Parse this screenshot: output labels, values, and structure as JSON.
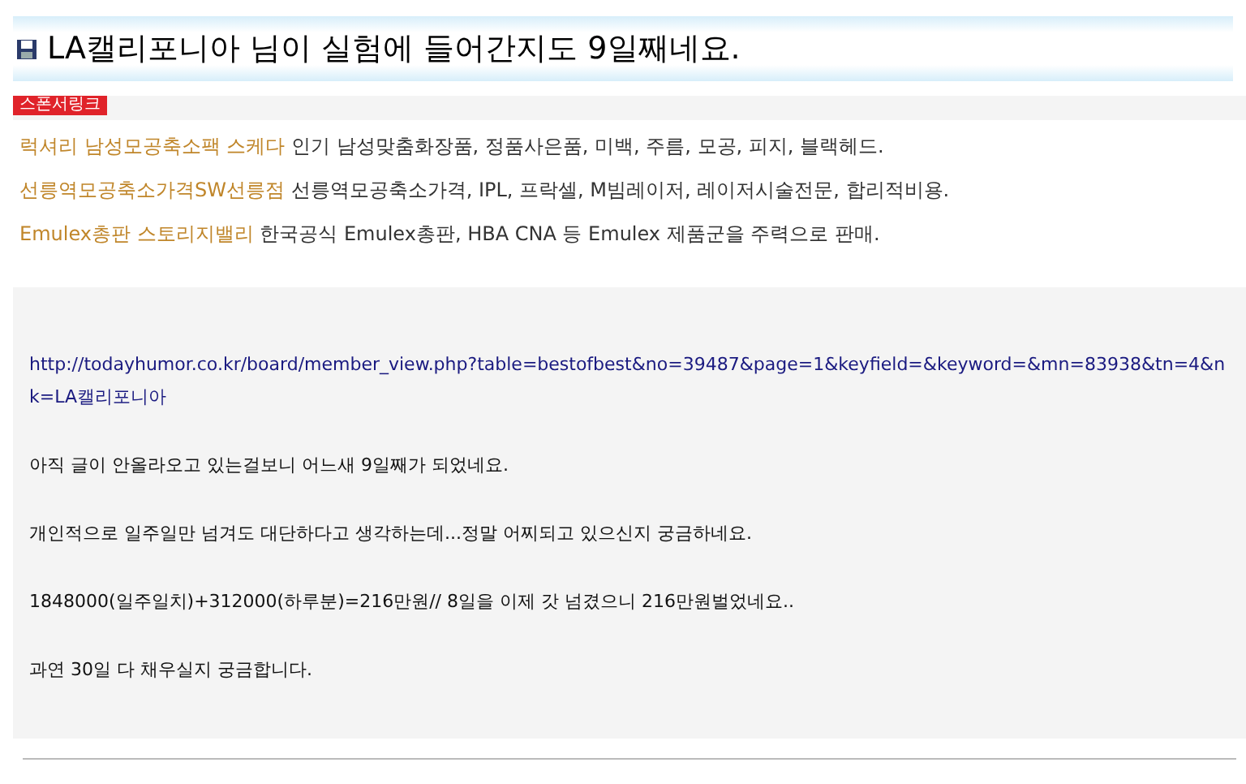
{
  "title": "LA캘리포니아 님이 실험에 들어간지도 9일째네요.",
  "sponsor": {
    "badge": "스폰서링크",
    "ads": [
      {
        "name": "럭셔리 남성모공축소팩 스케다",
        "desc": "인기 남성맞춤화장품, 정품사은품, 미백, 주름, 모공, 피지, 블랙헤드."
      },
      {
        "name": "선릉역모공축소가격SW선릉점",
        "desc": "선릉역모공축소가격, IPL, 프락셀, M빔레이저, 레이저시술전문, 합리적비용."
      },
      {
        "name": "Emulex총판 스토리지밸리",
        "desc": "한국공식 Emulex총판, HBA CNA 등 Emulex 제품군을 주력으로 판매."
      }
    ]
  },
  "post": {
    "link": "http://todayhumor.co.kr/board/member_view.php?table=bestofbest&no=39487&page=1&keyfield=&keyword=&mn=83938&tn=4&nk=LA캘리포니아",
    "paragraphs": [
      "아직 글이 안올라오고 있는걸보니 어느새 9일째가 되었네요.",
      "개인적으로 일주일만 넘겨도 대단하다고 생각하는데...정말 어찌되고 있으신지 궁금하네요.",
      "1848000(일주일치)+312000(하루분)=216만원// 8일을 이제 갓 넘겼으니 216만원벌었네요..",
      "과연 30일 다 채우실지 궁금합니다."
    ]
  }
}
